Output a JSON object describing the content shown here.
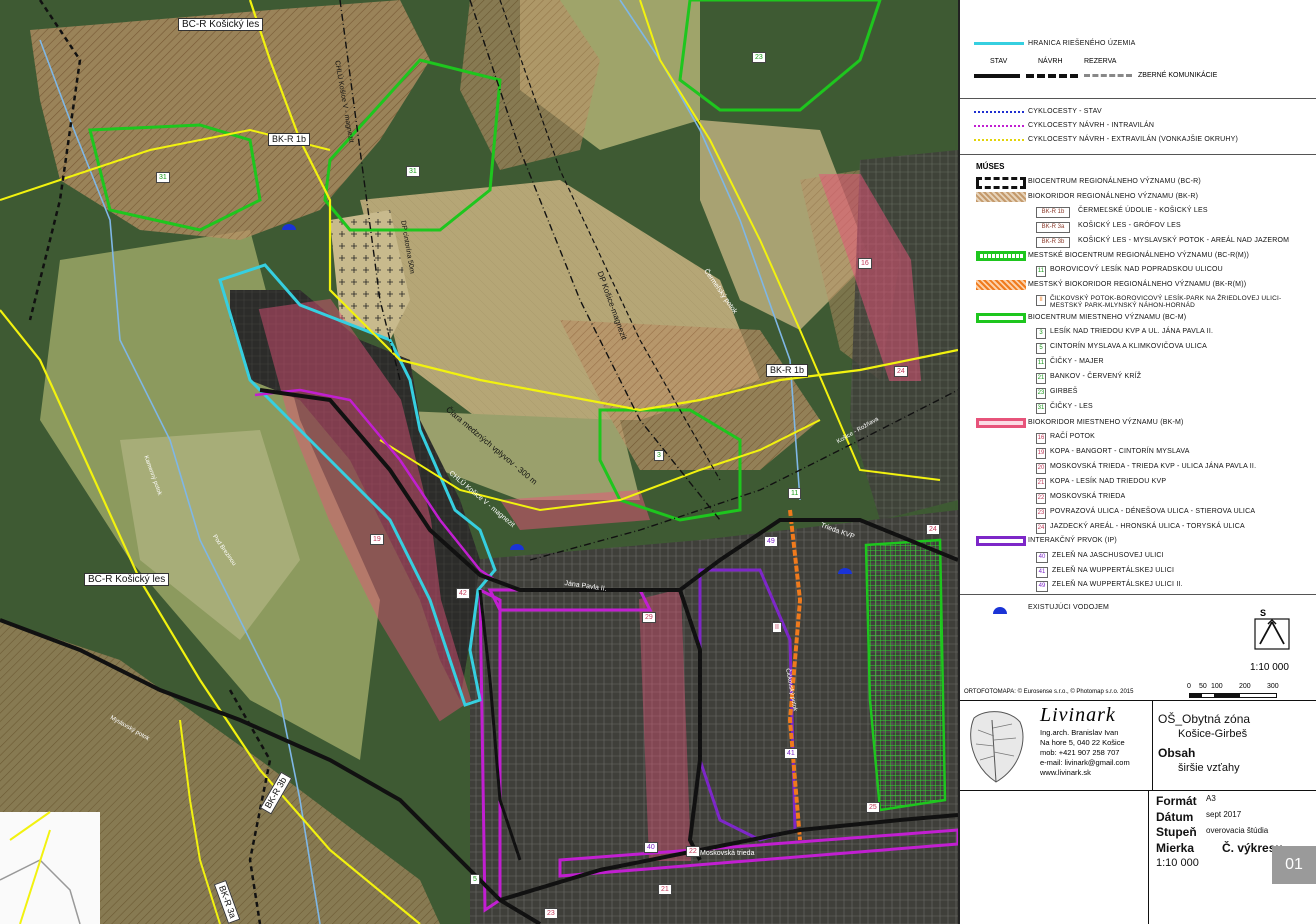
{
  "colors": {
    "forest": "#3c5532",
    "meadow": "#8f9a5c",
    "field": "#b6a77b",
    "hatch": "#c49a6c",
    "urban": "#3a3a3a",
    "pink": "#e7537a",
    "purple": "#c11fd1",
    "yellow": "#f2f20f",
    "cyan": "#36cfe0",
    "green": "#1ec61e",
    "violet": "#7d27c8",
    "orange": "#f07a1c"
  },
  "map": {
    "labels": {
      "bcr_kosicky_les_top": "BC-R Košický les",
      "bcr_kosicky_les_left": "BC-R Košický les",
      "bkr_1b_top": "BK-R 1b",
      "bkr_1b_right": "BK-R 1b",
      "bkr_3b": "BK-R 3b",
      "bkr_3a": "BK-R 3a",
      "chlu_vertical": "CHLÚ Košice V - magnezit",
      "chlu_lower": "CHLÚ Košice V - magnezit",
      "dp_cintorina": "DP cintorína 50m",
      "dp_kosice": "DP Košice-magnezit",
      "ciara": "Čiara medzných vplyvov - 300 m",
      "cermelsky": "Čermeľský potok",
      "kamenny": "Kamenný potok",
      "trieda_kvp": "Trieda KVP",
      "jana_pavla": "Jána Pavla II.",
      "moskovska": "Moskovská trieda",
      "myslavsky": "Myslavský potok",
      "cickovsky": "Čičkovský potok",
      "podbreziny": "Pod Brezinou",
      "kosice_roznava": "Košice - Rožňava"
    },
    "badges": [
      "23",
      "31",
      "31",
      "3",
      "16",
      "24",
      "11",
      "24",
      "49",
      "19",
      "29",
      "II",
      "40",
      "22",
      "41",
      "42",
      "25",
      "21",
      "5",
      "23"
    ]
  },
  "legend": {
    "hranica": "HRANICA RIEŠENÉHO ÚZEMIA",
    "col_stav": "STAV",
    "col_navrh": "NÁVRH",
    "col_rezerva": "REZERVA",
    "zberne": "ZBERNÉ KOMUNIKÁCIE",
    "cyklo_stav": "CYKLOCESTY - STAV",
    "cyklo_intravilan": "CYKLOCESTY NÁVRH - INTRAVILÁN",
    "cyklo_extravilan": "CYKLOCESTY NÁVRH - EXTRAVILÁN (VONKAJŠIE OKRUHY)",
    "muses": "MÚSES",
    "bcr": "BIOCENTRUM REGIONÁLNEHO VÝZNAMU (BC-R)",
    "bkr": "BIOKORIDOR REGIONÁLNEHO VÝZNAMU (BK-R)",
    "bkr_items": [
      {
        "code": "BK-R 1b",
        "label": "ČERMEĽSKÉ ÚDOLIE - KOŠICKÝ LES"
      },
      {
        "code": "BK-R 3a",
        "label": "KOŠICKÝ LES - GRÓFOV LES"
      },
      {
        "code": "BK-R 3b",
        "label": "KOŠICKÝ LES - MYSLAVSKÝ POTOK - AREÁL NAD JAZEROM"
      }
    ],
    "bcrm": "MESTSKÉ BIOCENTRUM REGIONÁLNEHO VÝZNAMU (BC-R(M))",
    "bcrm_items": [
      {
        "code": "11",
        "label": "BOROVICOVÝ LESÍK NAD POPRADSKOU ULICOU"
      }
    ],
    "bkrm": "MESTSKÝ BIOKORIDOR REGIONÁLNEHO VÝZNAMU (BK-R(M))",
    "bkrm_items": [
      {
        "code": "II",
        "label": "ČIĽKOVSKÝ POTOK-BOROVICOVÝ LESÍK-PARK NA ŽRIEDLOVEJ ULICI-MESTSKÝ PARK-MLYNSKÝ NÁHON-HORNÁD"
      }
    ],
    "bcm": "BIOCENTRUM MIESTNEHO VÝZNAMU (BC-M)",
    "bcm_items": [
      {
        "code": "3",
        "label": "LESÍK NAD TRIEDOU KVP A UL. JÁNA PAVLA II."
      },
      {
        "code": "5",
        "label": "CINTORÍN MYSLAVA A KLIMKOVIČOVA ULICA"
      },
      {
        "code": "11",
        "label": "ČIČKY - MAJER"
      },
      {
        "code": "21",
        "label": "BANKOV - ČERVENÝ KRÍŽ"
      },
      {
        "code": "23",
        "label": "GIRBEŠ"
      },
      {
        "code": "31",
        "label": "ČIČKY - LES"
      }
    ],
    "bkm": "BIOKORIDOR MIESTNEHO VÝZNAMU (BK-M)",
    "bkm_items": [
      {
        "code": "16",
        "label": "RAČÍ POTOK"
      },
      {
        "code": "19",
        "label": "KOPA - BANGORT - CINTORÍN MYSLAVA"
      },
      {
        "code": "20",
        "label": "MOSKOVSKÁ TRIEDA - TRIEDA KVP - ULICA JÁNA PAVLA II."
      },
      {
        "code": "21",
        "label": "KOPA - LESÍK NAD TRIEDOU KVP"
      },
      {
        "code": "22",
        "label": "MOSKOVSKÁ TRIEDA"
      },
      {
        "code": "23",
        "label": "POVRAZOVÁ ULICA - DÉNEŠOVA ULICA - STIEROVA ULICA"
      },
      {
        "code": "24",
        "label": "JAZDECKÝ AREÁL - HRONSKÁ ULICA - TORYSKÁ ULICA"
      }
    ],
    "ip": "INTERAKČNÝ PRVOK (IP)",
    "ip_items": [
      {
        "code": "40",
        "label": "ZELEŇ NA JASCHUSOVEJ ULICI"
      },
      {
        "code": "41",
        "label": "ZELEŇ NA WUPPERTÁLSKEJ ULICI"
      },
      {
        "code": "49",
        "label": "ZELEŇ NA WUPPERTÁLSKEJ ULICI II."
      }
    ],
    "vodojem": "EXISTUJÚCI VODOJEM",
    "north": "S",
    "scale_label": "1:10 000",
    "scale_ticks": [
      "0",
      "50",
      "100",
      "200",
      "300"
    ],
    "ortofoto": "ORTOFOTOMAPA: © Eurosense s.r.o., © Photomap s.r.o. 2015"
  },
  "titleblock": {
    "logo": "Livinark",
    "author_name": "Ing.arch. Branislav Ivan",
    "author_addr": "Na hore 5, 040 22 Košice",
    "author_mob": "mob: +421 907 258 707",
    "author_email": "e-mail: livinark@gmail.com",
    "author_web": "www.livinark.sk",
    "project_1": "OŠ_Obytná zóna",
    "project_2": "Košice-Girbeš",
    "obsah_label": "Obsah",
    "obsah_value": "širšie vzťahy",
    "format_label": "Formát",
    "format_value": "A3",
    "datum_label": "Dátum",
    "datum_value": "sept 2017",
    "stupen_label": "Stupeň",
    "stupen_value": "overovacia štúdia",
    "mierka_label": "Mierka",
    "mierka_value": "1:10 000",
    "cvykresu_label": "Č. výkresu",
    "sheet_number": "01"
  }
}
